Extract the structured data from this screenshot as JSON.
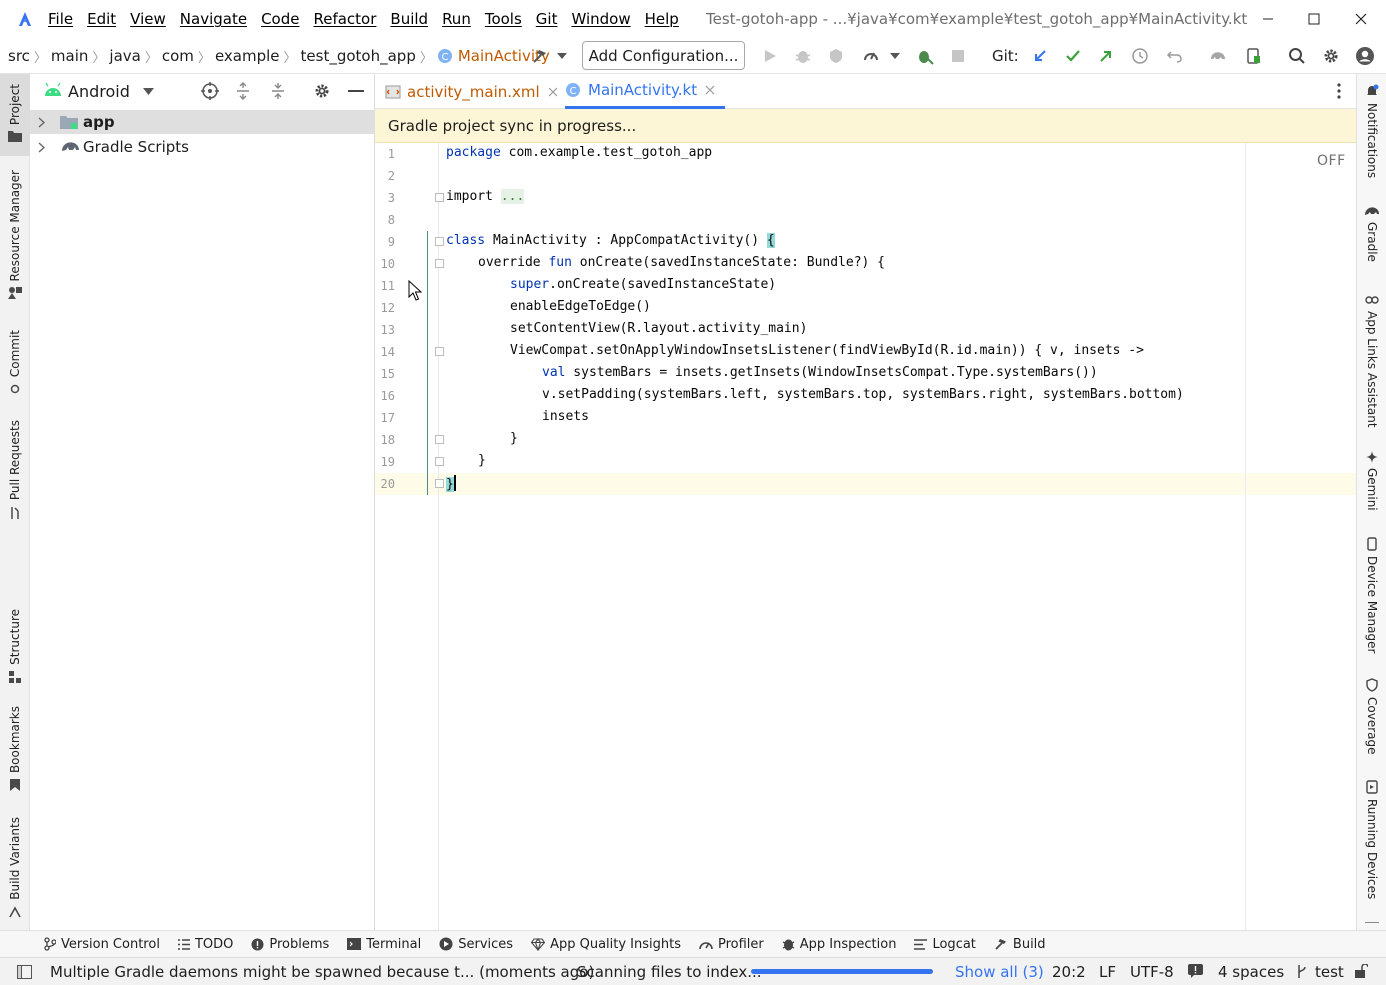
{
  "menu": [
    "File",
    "Edit",
    "View",
    "Navigate",
    "Code",
    "Refactor",
    "Build",
    "Run",
    "Tools",
    "Git",
    "Window",
    "Help"
  ],
  "window_title": "Test-gotoh-app - ...¥java¥com¥example¥test_gotoh_app¥MainActivity.kt",
  "breadcrumb": [
    "src",
    "main",
    "java",
    "com",
    "example",
    "test_gotoh_app",
    "MainActivity"
  ],
  "toolbar": {
    "config_label": "Add Configuration...",
    "git_label": "Git:"
  },
  "left_tools": [
    "Project",
    "Resource Manager",
    "Commit",
    "Pull Requests",
    "Structure",
    "Bookmarks",
    "Build Variants"
  ],
  "right_tools": [
    "Notifications",
    "Gradle",
    "App Links Assistant",
    "Gemini",
    "Device Manager",
    "Coverage",
    "Running Devices"
  ],
  "project_panel": {
    "view_mode": "Android",
    "tree": [
      {
        "label": "app",
        "bold": true,
        "selected": true
      },
      {
        "label": "Gradle Scripts",
        "bold": false,
        "selected": false
      }
    ]
  },
  "editor_tabs": [
    {
      "label": "activity_main.xml",
      "active": false
    },
    {
      "label": "MainActivity.kt",
      "active": true
    }
  ],
  "banner": "Gradle project sync in progress...",
  "editor": {
    "off_label": "OFF",
    "lines": [
      {
        "n": "1",
        "indent": 0,
        "tokens": [
          [
            "kw",
            "package"
          ],
          [
            "t",
            " com.example.test_gotoh_app"
          ]
        ]
      },
      {
        "n": "2",
        "indent": 0,
        "tokens": []
      },
      {
        "n": "3",
        "indent": 0,
        "tokens": [
          [
            "t",
            "import "
          ],
          [
            "fold",
            "..."
          ]
        ]
      },
      {
        "n": "8",
        "indent": 0,
        "tokens": []
      },
      {
        "n": "9",
        "indent": 0,
        "tokens": [
          [
            "kw",
            "class"
          ],
          [
            "t",
            " MainActivity : AppCompatActivity() "
          ],
          [
            "brace",
            "{"
          ]
        ]
      },
      {
        "n": "10",
        "indent": 1,
        "tokens": [
          [
            "t",
            "override "
          ],
          [
            "kw",
            "fun"
          ],
          [
            "t",
            " onCreate(savedInstanceState: Bundle?) {"
          ]
        ]
      },
      {
        "n": "11",
        "indent": 2,
        "tokens": [
          [
            "kw",
            "super"
          ],
          [
            "t",
            ".onCreate(savedInstanceState)"
          ]
        ]
      },
      {
        "n": "12",
        "indent": 2,
        "tokens": [
          [
            "t",
            "enableEdgeToEdge()"
          ]
        ]
      },
      {
        "n": "13",
        "indent": 2,
        "tokens": [
          [
            "t",
            "setContentView(R.layout.activity_main)"
          ]
        ]
      },
      {
        "n": "14",
        "indent": 2,
        "tokens": [
          [
            "t",
            "ViewCompat.setOnApplyWindowInsetsListener(findViewById(R.id.main)) { v, insets ->"
          ]
        ]
      },
      {
        "n": "15",
        "indent": 3,
        "tokens": [
          [
            "kw",
            "val"
          ],
          [
            "t",
            " systemBars = insets.getInsets(WindowInsetsCompat.Type.systemBars())"
          ]
        ]
      },
      {
        "n": "16",
        "indent": 3,
        "tokens": [
          [
            "t",
            "v.setPadding(systemBars.left, systemBars.top, systemBars.right, systemBars.bottom)"
          ]
        ]
      },
      {
        "n": "17",
        "indent": 3,
        "tokens": [
          [
            "t",
            "insets"
          ]
        ]
      },
      {
        "n": "18",
        "indent": 2,
        "tokens": [
          [
            "t",
            "}"
          ]
        ]
      },
      {
        "n": "19",
        "indent": 1,
        "tokens": [
          [
            "t",
            "}"
          ]
        ]
      },
      {
        "n": "20",
        "indent": 0,
        "tokens": [
          [
            "brace",
            "}"
          ]
        ]
      }
    ]
  },
  "bottom_tools": [
    "Version Control",
    "TODO",
    "Problems",
    "Terminal",
    "Services",
    "App Quality Insights",
    "Profiler",
    "App Inspection",
    "Logcat",
    "Build"
  ],
  "status": {
    "message": "Multiple Gradle daemons might be spawned because t... (moments ago)",
    "task": "Scanning files to index...",
    "progress": 1.0,
    "show_all": "Show all (3)",
    "position": "20:2",
    "line_sep": "LF",
    "encoding": "UTF-8",
    "indent": "4 spaces",
    "branch": "test"
  },
  "colors": {
    "accent": "#3574f0",
    "banner": "#fdf6d6",
    "keyword": "#0033b3",
    "crumb_active": "#c05a00"
  }
}
